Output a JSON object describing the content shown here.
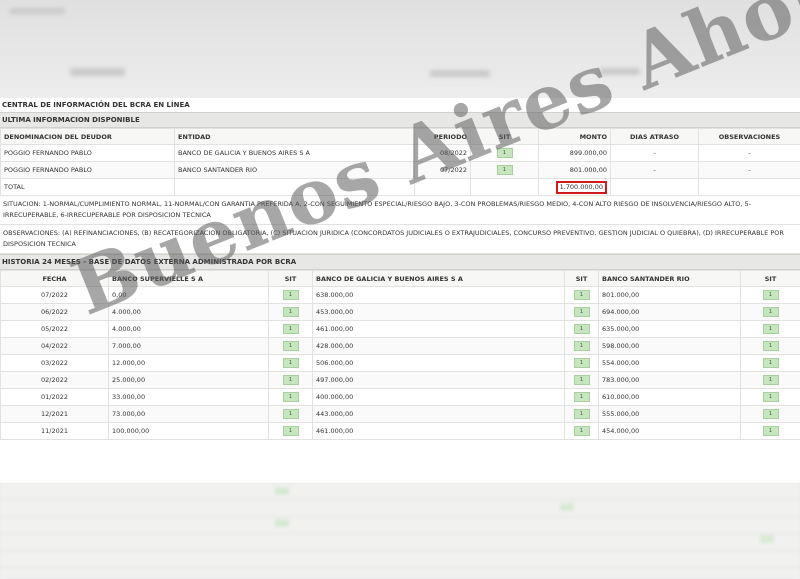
{
  "watermark": "Buenos Aires Ahora",
  "section_main": "CENTRAL DE INFORMACIÓN DEL BCRA EN LÍNEA",
  "section_last": "ULTIMA INFORMACION DISPONIBLE",
  "debts": {
    "headers": [
      "DENOMINACION DEL DEUDOR",
      "ENTIDAD",
      "PERIODO",
      "SIT",
      "MONTO",
      "DIAS ATRASO",
      "OBSERVACIONES"
    ],
    "rows": [
      {
        "deudor": "POGGIO FERNANDO PABLO",
        "entidad": "BANCO DE GALICIA Y BUENOS AIRES S A",
        "periodo": "08/2022",
        "sit": "1",
        "monto": "899.000,00",
        "dias": "-",
        "obs": "-"
      },
      {
        "deudor": "POGGIO FERNANDO PABLO",
        "entidad": "BANCO SANTANDER RIO",
        "periodo": "07/2022",
        "sit": "1",
        "monto": "801.000,00",
        "dias": "-",
        "obs": "-"
      }
    ],
    "total_label": "TOTAL",
    "total_value": "1.700.000,00"
  },
  "situacion_note": "SITUACION: 1-NORMAL/CUMPLIMIENTO NORMAL, 11-NORMAL/CON GARANTIA PREFERIDA A, 2-CON SEGUIMIENTO ESPECIAL/RIESGO BAJO, 3-CON PROBLEMAS/RIESGO MEDIO, 4-CON ALTO RIESGO DE INSOLVENCIA/RIESGO ALTO, 5-IRRECUPERABLE, 6-IRRECUPERABLE POR DISPOSICION TECNICA",
  "observaciones_note": "OBSERVACIONES: (A) REFINANCIACIONES, (B) RECATEGORIZACION OBLIGATORIA, (C) SITUACION JURIDICA (CONCORDATOS JUDICIALES O EXTRAJUDICIALES, CONCURSO PREVENTIVO, GESTION JUDICIAL O QUIEBRA), (D) IRRECUPERABLE POR DISPOSICION TECNICA",
  "section_history": "HISTORIA 24 MESES - BASE DE DATOS EXTERNA ADMINISTRADA POR BCRA",
  "history": {
    "headers": [
      "FECHA",
      "BANCO SUPERVIELLE S A",
      "SIT",
      "BANCO DE GALICIA Y BUENOS AIRES S A",
      "SIT",
      "BANCO SANTANDER RIO",
      "SIT"
    ],
    "rows": [
      {
        "fecha": "07/2022",
        "b1": "0,00",
        "s1": "1",
        "b2": "638.000,00",
        "s2": "1",
        "b3": "801.000,00",
        "s3": "1"
      },
      {
        "fecha": "06/2022",
        "b1": "4.000,00",
        "s1": "1",
        "b2": "453.000,00",
        "s2": "1",
        "b3": "694.000,00",
        "s3": "1"
      },
      {
        "fecha": "05/2022",
        "b1": "4.000,00",
        "s1": "1",
        "b2": "461.000,00",
        "s2": "1",
        "b3": "635.000,00",
        "s3": "1"
      },
      {
        "fecha": "04/2022",
        "b1": "7.000,00",
        "s1": "1",
        "b2": "428.000,00",
        "s2": "1",
        "b3": "598.000,00",
        "s3": "1"
      },
      {
        "fecha": "03/2022",
        "b1": "12.000,00",
        "s1": "1",
        "b2": "506.000,00",
        "s2": "1",
        "b3": "554.000,00",
        "s3": "1"
      },
      {
        "fecha": "02/2022",
        "b1": "25.000,00",
        "s1": "1",
        "b2": "497.000,00",
        "s2": "1",
        "b3": "783.000,00",
        "s3": "1"
      },
      {
        "fecha": "01/2022",
        "b1": "33.000,00",
        "s1": "1",
        "b2": "400.000,00",
        "s2": "1",
        "b3": "610.000,00",
        "s3": "1"
      },
      {
        "fecha": "12/2021",
        "b1": "73.000,00",
        "s1": "1",
        "b2": "443.000,00",
        "s2": "1",
        "b3": "555.000,00",
        "s3": "1"
      },
      {
        "fecha": "11/2021",
        "b1": "100.000,00",
        "s1": "1",
        "b2": "461.000,00",
        "s2": "1",
        "b3": "454.000,00",
        "s3": "1"
      }
    ]
  }
}
